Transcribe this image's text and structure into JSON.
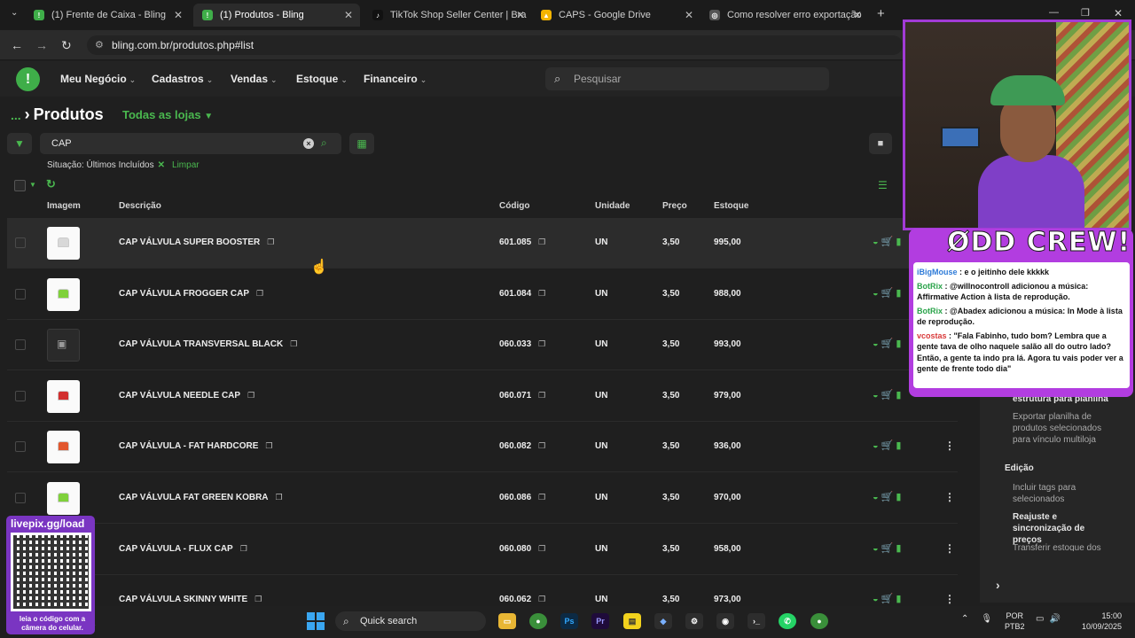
{
  "browser": {
    "tabs": [
      {
        "title": "(1) Frente de Caixa - Bling",
        "active": false
      },
      {
        "title": "(1) Produtos - Bling",
        "active": true
      },
      {
        "title": "TikTok Shop Seller Center | Bra",
        "active": false
      },
      {
        "title": "CAPS - Google Drive",
        "active": false
      },
      {
        "title": "Como resolver erro exportação",
        "active": false
      }
    ],
    "url": "bling.com.br/produtos.php#list"
  },
  "app": {
    "logo": "!",
    "menu": [
      "Meu Negócio",
      "Cadastros",
      "Vendas",
      "Estoque",
      "Financeiro"
    ],
    "search_placeholder": "Pesquisar"
  },
  "page": {
    "breadcrumb_dots": "...",
    "title": "Produtos",
    "store_selector": "Todas as lojas",
    "filter_value": "CAP",
    "situation_label": "Situação: Últimos Incluídos",
    "clear_label": "Limpar"
  },
  "table": {
    "headers": {
      "image": "Imagem",
      "description": "Descrição",
      "code": "Código",
      "unit": "Unidade",
      "price": "Preço",
      "stock": "Estoque"
    },
    "rows": [
      {
        "description": "CAP VÁLVULA SUPER BOOSTER",
        "code": "601.085",
        "unit": "UN",
        "price": "3,50",
        "stock": "995,00",
        "thumb_color": "#d8d8d8"
      },
      {
        "description": "CAP VÁLVULA FROGGER CAP",
        "code": "601.084",
        "unit": "UN",
        "price": "3,50",
        "stock": "988,00",
        "thumb_color": "#7fd13b"
      },
      {
        "description": "CAP VÁLVULA TRANSVERSAL BLACK",
        "code": "060.033",
        "unit": "UN",
        "price": "3,50",
        "stock": "993,00",
        "thumb_color": "placeholder"
      },
      {
        "description": "CAP VÁLVULA NEEDLE CAP",
        "code": "060.071",
        "unit": "UN",
        "price": "3,50",
        "stock": "979,00",
        "thumb_color": "#d22f2f"
      },
      {
        "description": "CAP VÁLVULA - FAT HARDCORE",
        "code": "060.082",
        "unit": "UN",
        "price": "3,50",
        "stock": "936,00",
        "thumb_color": "#e2572e"
      },
      {
        "description": "CAP VÁLVULA FAT GREEN KOBRA",
        "code": "060.086",
        "unit": "UN",
        "price": "3,50",
        "stock": "970,00",
        "thumb_color": "#7fd13b"
      },
      {
        "description": "CAP VÁLVULA - FLUX CAP",
        "code": "060.080",
        "unit": "UN",
        "price": "3,50",
        "stock": "958,00",
        "thumb_color": "#ffffff"
      },
      {
        "description": "CAP VÁLVULA SKINNY WHITE",
        "code": "060.062",
        "unit": "UN",
        "price": "3,50",
        "stock": "973,00",
        "thumb_color": "#ffffff"
      }
    ]
  },
  "side_panel": {
    "item_structure": "estrutura para planilha",
    "item_export": "Exportar planilha de produtos selecionados para vínculo multiloja",
    "section_edit": "Edição",
    "item_tags": "Incluir tags para selecionados",
    "item_reajuste": "Reajuste e sincronização de preços",
    "item_transfer": "Transferir estoque dos"
  },
  "stream": {
    "banner": "ØDD CREW!",
    "chat": [
      {
        "user": "iBigMouse",
        "text": "e o jeitinho dele kkkkk",
        "kind": "user"
      },
      {
        "user": "BotRix",
        "text": "@willnocontroll adicionou a música: Affirmative Action à lista de reprodução.",
        "kind": "bot"
      },
      {
        "user": "BotRix",
        "text": "@Abadex adicionou a música: In Mode à lista de reprodução.",
        "kind": "bot"
      },
      {
        "user": "vcostas",
        "text": "\"Fala Fabinho, tudo bom? Lembra que a gente tava de olho naquele salão all do outro lado? Então, a gente ta indo pra lá. Agora tu vais poder ver a gente de frente todo dia\"",
        "kind": "red"
      }
    ],
    "qr_title": "livepix.gg/load",
    "qr_caption": "leia o código com a câmera do celular."
  },
  "taskbar": {
    "search_label": "Quick search",
    "lang_top": "POR",
    "lang_bottom": "PTB2",
    "time": "15:00",
    "date": "10/09/2025"
  }
}
